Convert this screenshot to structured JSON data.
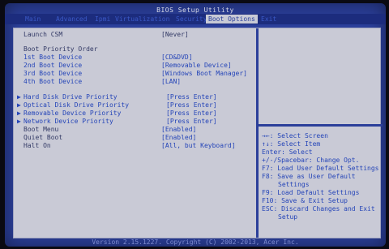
{
  "title": "BIOS Setup Utility",
  "menu": [
    "Main",
    "Advanced",
    "Ipmi",
    "Virtualization",
    "Security",
    "Boot Options",
    "Exit"
  ],
  "active_menu": "Boot Options",
  "settings": {
    "launch_csm": {
      "label": "Launch CSM",
      "value": "[Never]"
    },
    "boot_priority_order": "Boot Priority Order",
    "boot1": {
      "label": "1st Boot Device",
      "value": "[CD&DVD]"
    },
    "boot2": {
      "label": "2nd Boot Device",
      "value": "[Removable Device]"
    },
    "boot3": {
      "label": "3rd Boot Device",
      "value": "[Windows Boot Manager]"
    },
    "boot4": {
      "label": "4th Boot Device",
      "value": "[LAN]"
    },
    "hdd_priority": {
      "label": "Hard Disk Drive Priority",
      "value": "[Press Enter]"
    },
    "odd_priority": {
      "label": "Optical Disk Drive Priority",
      "value": "[Press Enter]"
    },
    "removable_priority": {
      "label": "Removable Device Priority",
      "value": "[Press Enter]"
    },
    "network_priority": {
      "label": "Network Device Priority",
      "value": "[Press Enter]"
    },
    "boot_menu": {
      "label": "Boot Menu",
      "value": "[Enabled]"
    },
    "quiet_boot": {
      "label": "Quiet Boot",
      "value": "[Enabled]"
    },
    "halt_on": {
      "label": "Halt On",
      "value": "[All, but Keyboard]"
    }
  },
  "help": {
    "select_screen": "→←: Select Screen",
    "select_item": "↑↓: Select Item",
    "enter": "Enter: Select",
    "change": "+/-/Spacebar: Change Opt.",
    "f7": "F7: Load User Default Settings",
    "f8a": "F8: Save as User Default",
    "f8b": "Settings",
    "f9": "F9: Load Default Settings",
    "f10": "F10: Save & Exit Setup",
    "esc_a": "ESC: Discard Changes and Exit",
    "esc_b": "Setup"
  },
  "footer": "Version 2.15.1227. Copyright (C) 2002-2013, Acer Inc."
}
